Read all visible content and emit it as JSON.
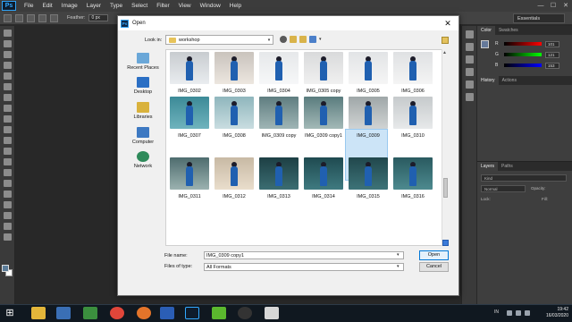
{
  "app": {
    "logo": "Ps",
    "menus": [
      "File",
      "Edit",
      "Image",
      "Layer",
      "Type",
      "Select",
      "Filter",
      "View",
      "Window",
      "Help"
    ],
    "window_buttons": [
      "—",
      "☐",
      "✕"
    ],
    "options": {
      "feather_label": "Feather:",
      "feather_value": "0 px"
    },
    "workspace": "Essentials"
  },
  "panels": {
    "color_tabs": [
      "Color",
      "Swatches"
    ],
    "color_values": {
      "R": "101",
      "G": "121",
      "B": "153"
    },
    "history_tabs": [
      "History",
      "Actions"
    ],
    "layers_tabs": [
      "Layers",
      "Paths"
    ],
    "layers_kind": "Kind",
    "blend_mode": "Normal",
    "opacity_label": "Opacity:",
    "lock_label": "Lock:",
    "fill_label": "Fill:"
  },
  "dialog": {
    "title": "Open",
    "close": "✕",
    "look_in_label": "Look in:",
    "look_in_value": "workshop",
    "places": [
      "Recent Places",
      "Desktop",
      "Libraries",
      "Computer",
      "Network"
    ],
    "files": [
      {
        "name": "IMG_0302"
      },
      {
        "name": "IMG_0303"
      },
      {
        "name": "IMG_0304"
      },
      {
        "name": "IMG_0305 copy"
      },
      {
        "name": "IMG_0305"
      },
      {
        "name": "IMG_0306"
      },
      {
        "name": "IMG_0307"
      },
      {
        "name": "IMG_0308"
      },
      {
        "name": "IMG_0309 copy"
      },
      {
        "name": "IMG_0309 copy1"
      },
      {
        "name": "IMG_0309"
      },
      {
        "name": "IMG_0310"
      },
      {
        "name": "IMG_0311"
      },
      {
        "name": "IMG_0312"
      },
      {
        "name": "IMG_0313"
      },
      {
        "name": "IMG_0314"
      },
      {
        "name": "IMG_0315"
      },
      {
        "name": "IMG_0316"
      }
    ],
    "selected_file": "IMG_0309 copy1",
    "file_name_label": "File name:",
    "file_name_value": "IMG_0309 copy1",
    "file_type_label": "Files of type:",
    "file_type_value": "All Formats",
    "open_label": "Open",
    "cancel_label": "Cancel"
  },
  "taskbar": {
    "start": "⊞",
    "ime": "IN",
    "time": "19:42",
    "date": "16/03/2020"
  },
  "colors": {
    "accent": "#0078d7",
    "ps_blue": "#31a8ff",
    "selection": "#cce4f7"
  }
}
